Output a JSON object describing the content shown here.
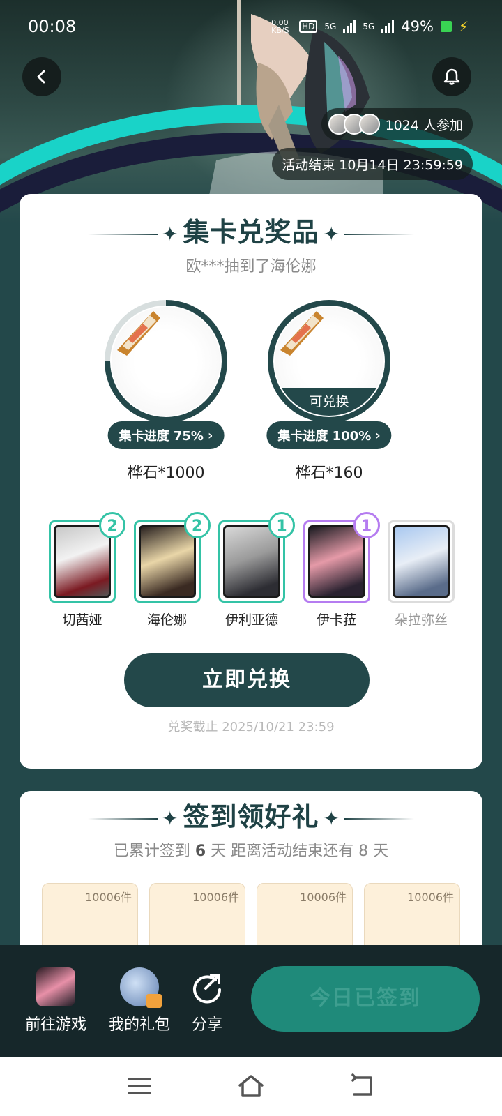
{
  "status_bar": {
    "time": "00:08",
    "net_speed": "0.00 KB/S",
    "signal_1": "5G",
    "signal_2": "5G",
    "battery": "49%"
  },
  "header": {
    "participants_text": "1024 人参加",
    "end_time_text": "活动结束 10月14日 23:59:59"
  },
  "card_exchange": {
    "title": "集卡兑奖品",
    "subtitle": "欧***抽到了海伦娜",
    "prizes": [
      {
        "name": "桦石*1000",
        "progress_label": "集卡进度 75%",
        "progress": 0.75,
        "redeemable": false
      },
      {
        "name": "桦石*160",
        "progress_label": "集卡进度 100%",
        "progress": 1.0,
        "redeemable": true,
        "redeem_label": "可兑换"
      }
    ],
    "characters": [
      {
        "name": "切茜娅",
        "count": "2",
        "style": "teal"
      },
      {
        "name": "海伦娜",
        "count": "2",
        "style": "teal"
      },
      {
        "name": "伊利亚德",
        "count": "1",
        "style": "teal"
      },
      {
        "name": "伊卡菈",
        "count": "1",
        "style": "purple"
      },
      {
        "name": "朵拉弥丝",
        "count": "",
        "style": "gray"
      }
    ],
    "redeem_button": "立即兑换",
    "deadline": "兑奖截止 2025/10/21 23:59"
  },
  "sign_in": {
    "title": "签到领好礼",
    "subtitle_prefix": "已累计签到",
    "days_signed": "6",
    "subtitle_mid": "天  距离活动结束还有",
    "days_left": "8",
    "subtitle_suffix": "天",
    "gifts": [
      {
        "qty": "10006件"
      },
      {
        "qty": "10006件"
      },
      {
        "qty": "10006件"
      },
      {
        "qty": "10006件"
      }
    ]
  },
  "bottom_bar": {
    "go_game": "前往游戏",
    "my_gifts": "我的礼包",
    "share": "分享",
    "signed_button": "今日已签到"
  },
  "colors": {
    "primary": "#23484a",
    "teal_accent": "#34c3a6",
    "purple_accent": "#b57cf0",
    "signed_button": "#1f8a7a"
  }
}
